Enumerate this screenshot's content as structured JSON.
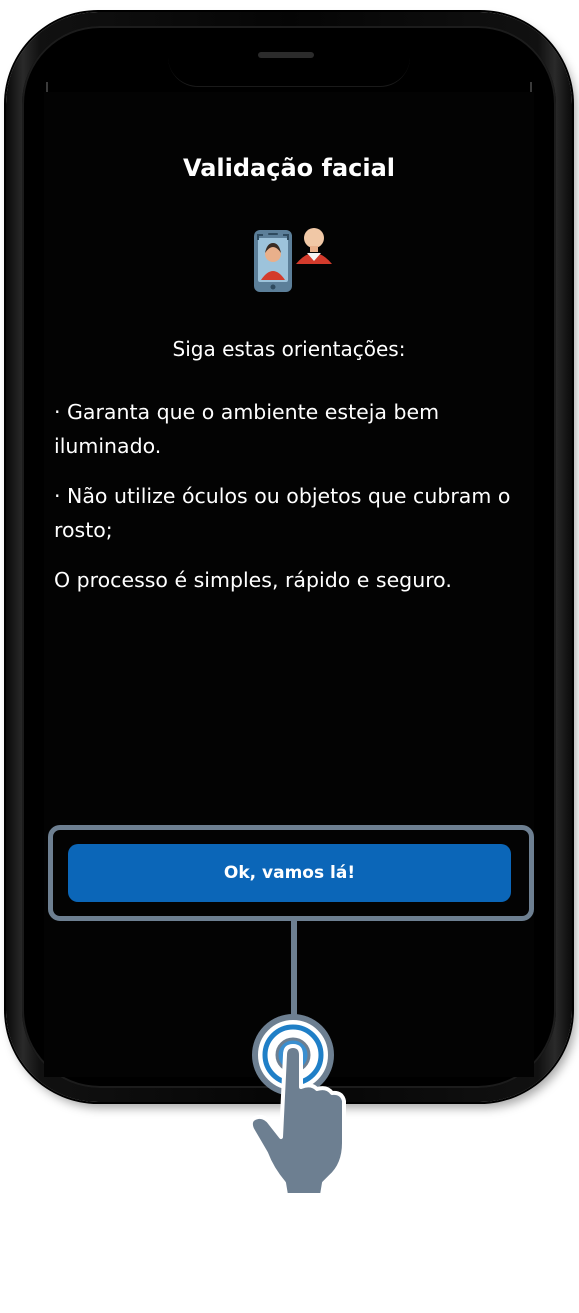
{
  "screen": {
    "title": "Validação facial",
    "icon": "face-validation-icon",
    "subtitle": "Siga estas orientações:",
    "paragraphs": [
      "· Garanta que o ambiente esteja bem iluminado.",
      "· Não utilize óculos ou objetos que cubram o rosto;",
      "O processo é simples, rápido e seguro."
    ],
    "button_label": "Ok, vamos lá!"
  },
  "overlay": {
    "pointer_icon": "tap-hand-icon"
  },
  "colors": {
    "background": "#030303",
    "button": "#0b66b8",
    "highlight": "#6d7f91",
    "text": "#ffffff"
  }
}
